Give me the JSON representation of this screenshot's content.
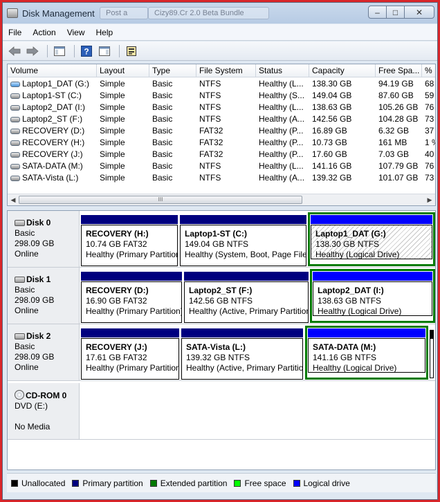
{
  "window": {
    "title": "Disk Management",
    "ghost_tabs": [
      "Post a",
      "Cizy89.Cr 2.0 Beta Bundle"
    ]
  },
  "menu": [
    "File",
    "Action",
    "View",
    "Help"
  ],
  "volume_list": {
    "columns": [
      "Volume",
      "Layout",
      "Type",
      "File System",
      "Status",
      "Capacity",
      "Free Spa...",
      "% F"
    ],
    "rows": [
      {
        "volume": "Laptop1_DAT (G:)",
        "icon": "blue",
        "layout": "Simple",
        "type": "Basic",
        "fs": "NTFS",
        "status": "Healthy (L...",
        "capacity": "138.30 GB",
        "free": "94.19 GB",
        "pct": "68"
      },
      {
        "volume": "Laptop1-ST (C:)",
        "icon": "gray",
        "layout": "Simple",
        "type": "Basic",
        "fs": "NTFS",
        "status": "Healthy (S...",
        "capacity": "149.04 GB",
        "free": "87.60 GB",
        "pct": "59"
      },
      {
        "volume": "Laptop2_DAT (I:)",
        "icon": "gray",
        "layout": "Simple",
        "type": "Basic",
        "fs": "NTFS",
        "status": "Healthy (L...",
        "capacity": "138.63 GB",
        "free": "105.26 GB",
        "pct": "76"
      },
      {
        "volume": "Laptop2_ST (F:)",
        "icon": "gray",
        "layout": "Simple",
        "type": "Basic",
        "fs": "NTFS",
        "status": "Healthy (A...",
        "capacity": "142.56 GB",
        "free": "104.28 GB",
        "pct": "73"
      },
      {
        "volume": "RECOVERY (D:)",
        "icon": "gray",
        "layout": "Simple",
        "type": "Basic",
        "fs": "FAT32",
        "status": "Healthy (P...",
        "capacity": "16.89 GB",
        "free": "6.32 GB",
        "pct": "37"
      },
      {
        "volume": "RECOVERY (H:)",
        "icon": "gray",
        "layout": "Simple",
        "type": "Basic",
        "fs": "FAT32",
        "status": "Healthy (P...",
        "capacity": "10.73 GB",
        "free": "161 MB",
        "pct": "1 %"
      },
      {
        "volume": "RECOVERY (J:)",
        "icon": "gray",
        "layout": "Simple",
        "type": "Basic",
        "fs": "FAT32",
        "status": "Healthy (P...",
        "capacity": "17.60 GB",
        "free": "7.03 GB",
        "pct": "40"
      },
      {
        "volume": "SATA-DATA (M:)",
        "icon": "gray",
        "layout": "Simple",
        "type": "Basic",
        "fs": "NTFS",
        "status": "Healthy (L...",
        "capacity": "141.16 GB",
        "free": "107.79 GB",
        "pct": "76"
      },
      {
        "volume": "SATA-Vista (L:)",
        "icon": "gray",
        "layout": "Simple",
        "type": "Basic",
        "fs": "NTFS",
        "status": "Healthy (A...",
        "capacity": "139.32 GB",
        "free": "101.07 GB",
        "pct": "73"
      }
    ],
    "scroll_thumb_label": "III"
  },
  "disks": [
    {
      "name": "Disk 0",
      "type": "Basic",
      "size": "298.09 GB",
      "status": "Online",
      "partitions": [
        {
          "name": "RECOVERY  (H:)",
          "detail": "10.74 GB FAT32",
          "status": "Healthy (Primary Partition)",
          "kind": "primary"
        },
        {
          "name": "Laptop1-ST  (C:)",
          "detail": "149.04 GB NTFS",
          "status": "Healthy (System, Boot, Page File)",
          "kind": "primary"
        },
        {
          "name": "Laptop1_DAT  (G:)",
          "detail": "138.30 GB NTFS",
          "status": "Healthy (Logical Drive)",
          "kind": "logical-selected"
        }
      ]
    },
    {
      "name": "Disk 1",
      "type": "Basic",
      "size": "298.09 GB",
      "status": "Online",
      "partitions": [
        {
          "name": "RECOVERY  (D:)",
          "detail": "16.90 GB FAT32",
          "status": "Healthy (Primary Partition)",
          "kind": "primary"
        },
        {
          "name": "Laptop2_ST  (F:)",
          "detail": "142.56 GB NTFS",
          "status": "Healthy (Active, Primary Partition)",
          "kind": "primary"
        },
        {
          "name": "Laptop2_DAT  (I:)",
          "detail": "138.63 GB NTFS",
          "status": "Healthy (Logical Drive)",
          "kind": "logical"
        }
      ]
    },
    {
      "name": "Disk 2",
      "type": "Basic",
      "size": "298.09 GB",
      "status": "Online",
      "partitions": [
        {
          "name": "RECOVERY  (J:)",
          "detail": "17.61 GB FAT32",
          "status": "Healthy (Primary Partition)",
          "kind": "primary"
        },
        {
          "name": "SATA-Vista  (L:)",
          "detail": "139.32 GB NTFS",
          "status": "Healthy (Active, Primary Partition)",
          "kind": "primary"
        },
        {
          "name": "SATA-DATA  (M:)",
          "detail": "141.16 GB NTFS",
          "status": "Healthy (Logical Drive)",
          "kind": "logical"
        }
      ]
    }
  ],
  "cdrom": {
    "name": "CD-ROM 0",
    "type": "DVD (E:)",
    "status": "No Media"
  },
  "legend": [
    {
      "label": "Unallocated",
      "color": "#000000"
    },
    {
      "label": "Primary partition",
      "color": "#00007f"
    },
    {
      "label": "Extended partition",
      "color": "#007a00"
    },
    {
      "label": "Free space",
      "color": "#00ff00"
    },
    {
      "label": "Logical drive",
      "color": "#0000ff"
    }
  ],
  "colors": {
    "primary": "#00007f",
    "logical": "#0000ff",
    "extended": "#007a00"
  }
}
